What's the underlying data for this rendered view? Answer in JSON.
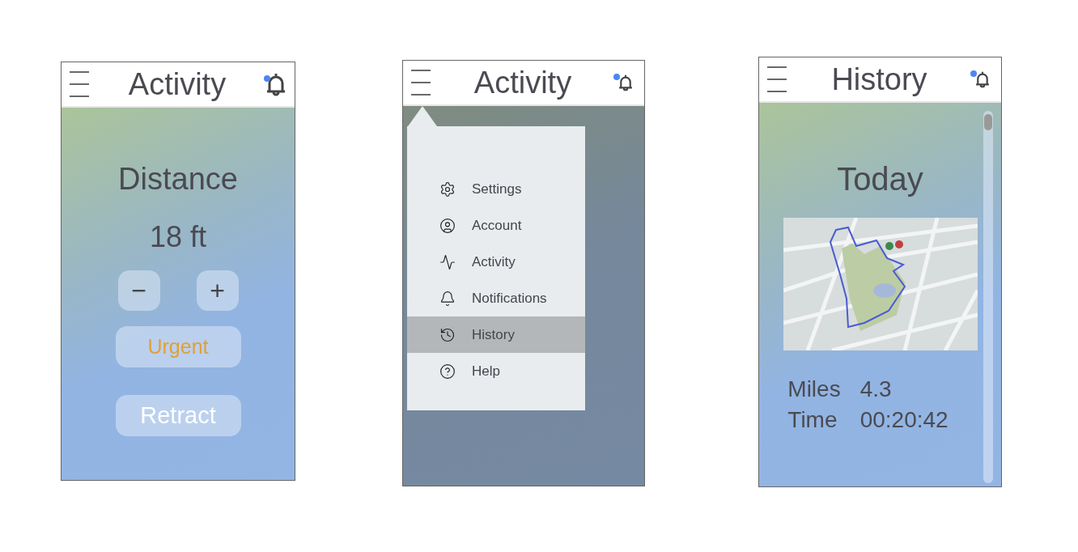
{
  "screens": [
    {
      "kind": "control",
      "title": "Activity",
      "unread": true,
      "heading": "Distance",
      "value": "18 ft",
      "stepper": [
        "−",
        "+"
      ],
      "buttons": [
        {
          "label": "Urgent",
          "kind": "urgent"
        },
        {
          "label": "Retract",
          "kind": "plain"
        }
      ]
    },
    {
      "kind": "menu",
      "title": "Activity",
      "unread": true,
      "menu": [
        {
          "label": "Settings",
          "kind": "settings",
          "selected": false
        },
        {
          "label": "Account",
          "kind": "account",
          "selected": false
        },
        {
          "label": "Activity",
          "kind": "activity",
          "selected": false
        },
        {
          "label": "Notifications",
          "kind": "notifications",
          "selected": false
        },
        {
          "label": "History",
          "kind": "history",
          "selected": true
        },
        {
          "label": "Help",
          "kind": "help",
          "selected": false
        }
      ]
    },
    {
      "kind": "history",
      "title": "History",
      "unread": true,
      "heading": "Today",
      "map": {
        "kind": "picture"
      },
      "stats": [
        {
          "label": "Miles",
          "value": "4.3"
        },
        {
          "label": "Time",
          "value": "00:20:42"
        }
      ]
    }
  ]
}
